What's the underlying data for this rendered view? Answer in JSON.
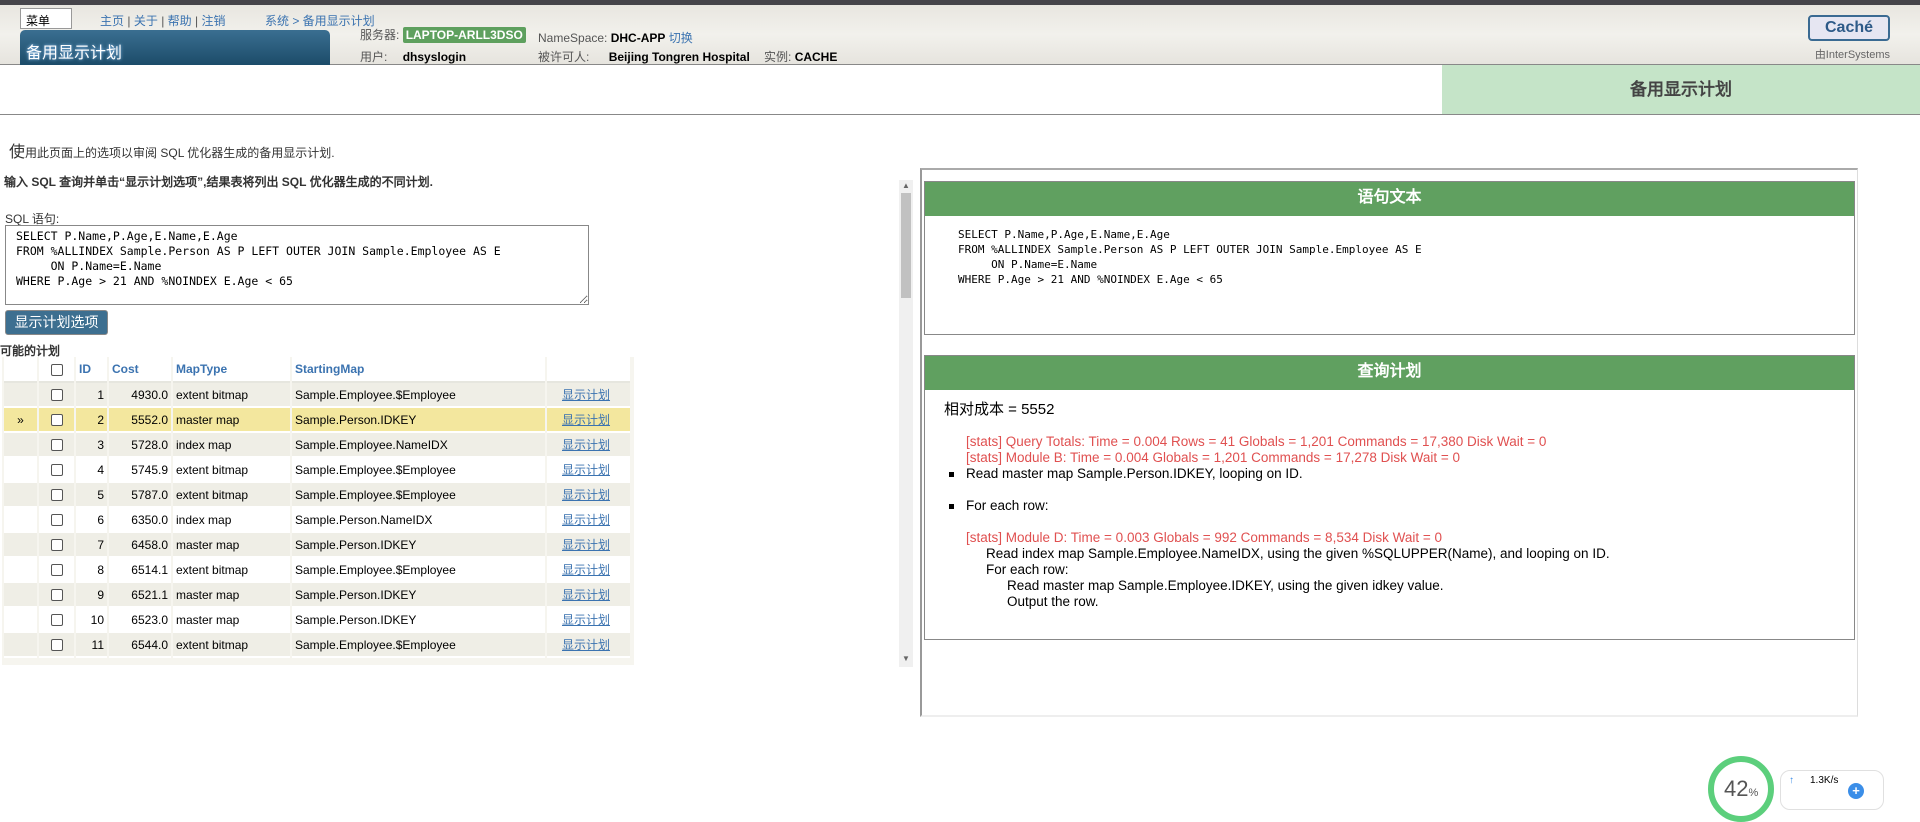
{
  "header": {
    "menu_label": "菜单",
    "links": [
      "主页",
      "关于",
      "帮助",
      "注销"
    ],
    "breadcrumb": "系统 > 备用显示计划",
    "page_title": "备用显示计划",
    "server_label": "服务器:",
    "server": "LAPTOP-ARLL3DSO",
    "namespace_label": "NameSpace:",
    "namespace": "DHC-APP",
    "switch_label": "切换",
    "user_label": "用户:",
    "user": "dhsyslogin",
    "licensee_label": "被许可人:",
    "licensee": "Beijing Tongren Hospital",
    "instance_label": "实例:",
    "instance": "CACHE",
    "brand": "Caché",
    "by": "由InterSystems"
  },
  "title_bar": {
    "title": "备用显示计划"
  },
  "left": {
    "intro_first": "使",
    "intro_rest": "用此页面上的选项以审阅 SQL 优化器生成的备用显示计划.",
    "instructions": "输入 SQL 查询并单击“显示计划选项”,结果表将列出 SQL 优化器生成的不同计划.",
    "sql_label": "SQL 语句:",
    "sql": "SELECT P.Name,P.Age,E.Name,E.Age\nFROM %ALLINDEX Sample.Person AS P LEFT OUTER JOIN Sample.Employee AS E\n     ON P.Name=E.Name\nWHERE P.Age > 21 AND %NOINDEX E.Age < 65",
    "show_button": "显示计划选项",
    "plans_label": "可能的计划",
    "columns": [
      "ID",
      "Cost",
      "MapType",
      "StartingMap"
    ],
    "link_label": "显示计划",
    "selected_marker": "»",
    "rows": [
      {
        "id": "1",
        "cost": "4930.0",
        "maptype": "extent bitmap",
        "map": "Sample.Employee.$Employee"
      },
      {
        "id": "2",
        "cost": "5552.0",
        "maptype": "master map",
        "map": "Sample.Person.IDKEY",
        "selected": true
      },
      {
        "id": "3",
        "cost": "5728.0",
        "maptype": "index map",
        "map": "Sample.Employee.NameIDX"
      },
      {
        "id": "4",
        "cost": "5745.9",
        "maptype": "extent bitmap",
        "map": "Sample.Employee.$Employee"
      },
      {
        "id": "5",
        "cost": "5787.0",
        "maptype": "extent bitmap",
        "map": "Sample.Employee.$Employee"
      },
      {
        "id": "6",
        "cost": "6350.0",
        "maptype": "index map",
        "map": "Sample.Person.NameIDX"
      },
      {
        "id": "7",
        "cost": "6458.0",
        "maptype": "master map",
        "map": "Sample.Person.IDKEY"
      },
      {
        "id": "8",
        "cost": "6514.1",
        "maptype": "extent bitmap",
        "map": "Sample.Employee.$Employee"
      },
      {
        "id": "9",
        "cost": "6521.1",
        "maptype": "master map",
        "map": "Sample.Person.IDKEY"
      },
      {
        "id": "10",
        "cost": "6523.0",
        "maptype": "master map",
        "map": "Sample.Person.IDKEY"
      },
      {
        "id": "11",
        "cost": "6544.0",
        "maptype": "extent bitmap",
        "map": "Sample.Employee.$Employee"
      }
    ]
  },
  "right": {
    "statement_title": "语句文本",
    "statement": "SELECT P.Name,P.Age,E.Name,E.Age\nFROM %ALLINDEX Sample.Person AS P LEFT OUTER JOIN Sample.Employee AS E\n     ON P.Name=E.Name\nWHERE P.Age > 21 AND %NOINDEX E.Age < 65",
    "plan_title": "查询计划",
    "relative_cost": "相对成本 = 5552",
    "stats_totals": "[stats] Query Totals: Time = 0.004 Rows = 41 Globals = 1,201 Commands = 17,380 Disk Wait = 0",
    "stats_b": "[stats] Module B: Time = 0.004 Globals = 1,201 Commands = 17,278 Disk Wait = 0",
    "step1": "Read master map Sample.Person.IDKEY, looping on ID.",
    "step2": "For each row:",
    "stats_d": "[stats] Module D: Time = 0.003 Globals = 992 Commands = 8,534 Disk Wait = 0",
    "sub1": "Read index map Sample.Employee.NameIDX, using the given %SQLUPPER(Name), and looping on ID.",
    "sub2": "For each row:",
    "sub3": "Read master map Sample.Employee.IDKEY, using the given idkey value.",
    "sub4": "Output the row."
  },
  "widget": {
    "percent": "42",
    "percent_unit": "%",
    "speed": "1.3K/s"
  },
  "colors": {
    "accent_green": "#60a060",
    "title_green": "#c5e4c8",
    "selected_row": "#f3e79e",
    "link": "#3b73b0",
    "stats_red": "#e05050"
  }
}
